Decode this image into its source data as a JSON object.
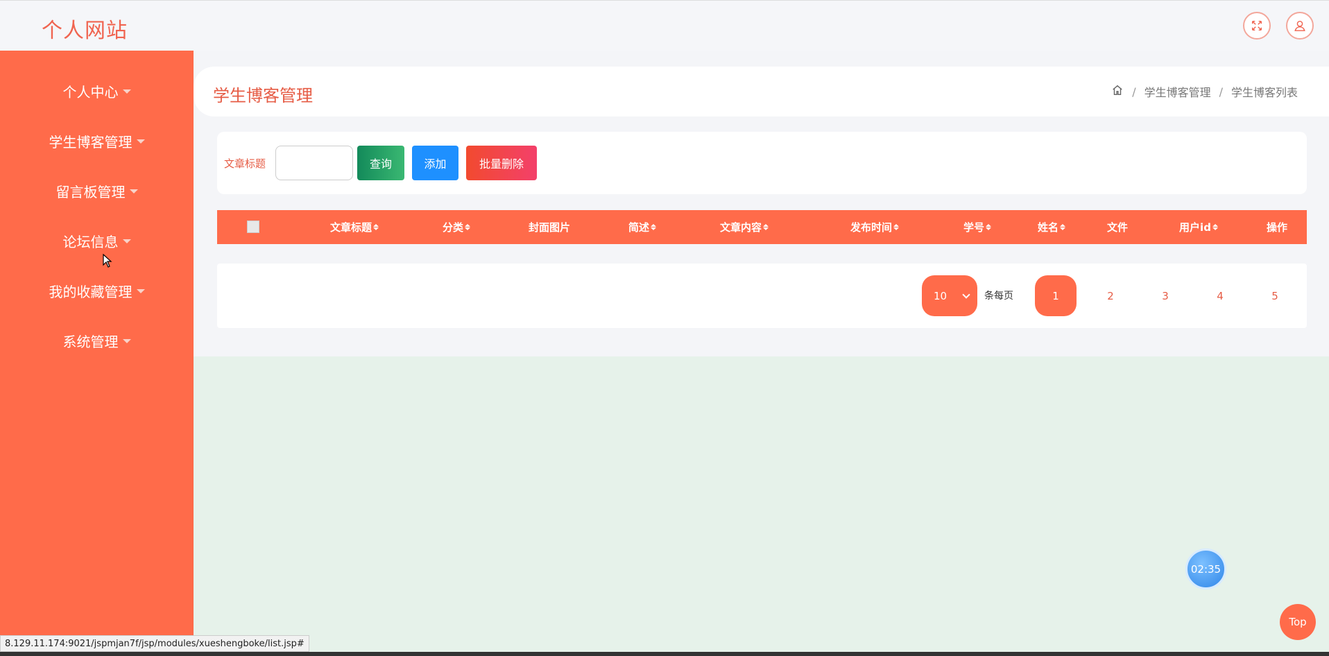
{
  "header": {
    "brand": "个人网站",
    "fullscreen_icon": "expand-icon",
    "user_icon": "user-icon"
  },
  "sidebar": {
    "items": [
      {
        "label": "个人中心"
      },
      {
        "label": "学生博客管理"
      },
      {
        "label": "留言板管理"
      },
      {
        "label": "论坛信息"
      },
      {
        "label": "我的收藏管理"
      },
      {
        "label": "系统管理"
      }
    ]
  },
  "page": {
    "title": "学生博客管理",
    "breadcrumb": [
      "学生博客管理",
      "学生博客列表"
    ],
    "breadcrumb_sep": "/"
  },
  "search": {
    "label": "文章标题",
    "value": "",
    "query_label": "查询",
    "add_label": "添加",
    "batch_delete_label": "批量删除"
  },
  "table": {
    "columns": [
      {
        "label": "文章标题",
        "sortable": true
      },
      {
        "label": "分类",
        "sortable": true
      },
      {
        "label": "封面图片",
        "sortable": false
      },
      {
        "label": "简述",
        "sortable": true
      },
      {
        "label": "文章内容",
        "sortable": true
      },
      {
        "label": "发布时间",
        "sortable": true
      },
      {
        "label": "学号",
        "sortable": true
      },
      {
        "label": "姓名",
        "sortable": true
      },
      {
        "label": "文件",
        "sortable": false
      },
      {
        "label": "用户id",
        "sortable": true
      },
      {
        "label": "操作",
        "sortable": false
      }
    ]
  },
  "pagination": {
    "page_size": "10",
    "per_page_label": "条每页",
    "pages": [
      "1",
      "2",
      "3",
      "4",
      "5"
    ],
    "current": "1"
  },
  "floating": {
    "timer": "02:35",
    "top_label": "Top"
  },
  "statusbar": {
    "url": "8.129.11.174:9021/jspmjan7f/jsp/modules/xueshengboke/list.jsp#"
  },
  "colors": {
    "primary": "#ff6b4a",
    "title": "#e65c45",
    "query": "#138a5a",
    "add": "#1e90ff",
    "delete": "#f3406a"
  }
}
